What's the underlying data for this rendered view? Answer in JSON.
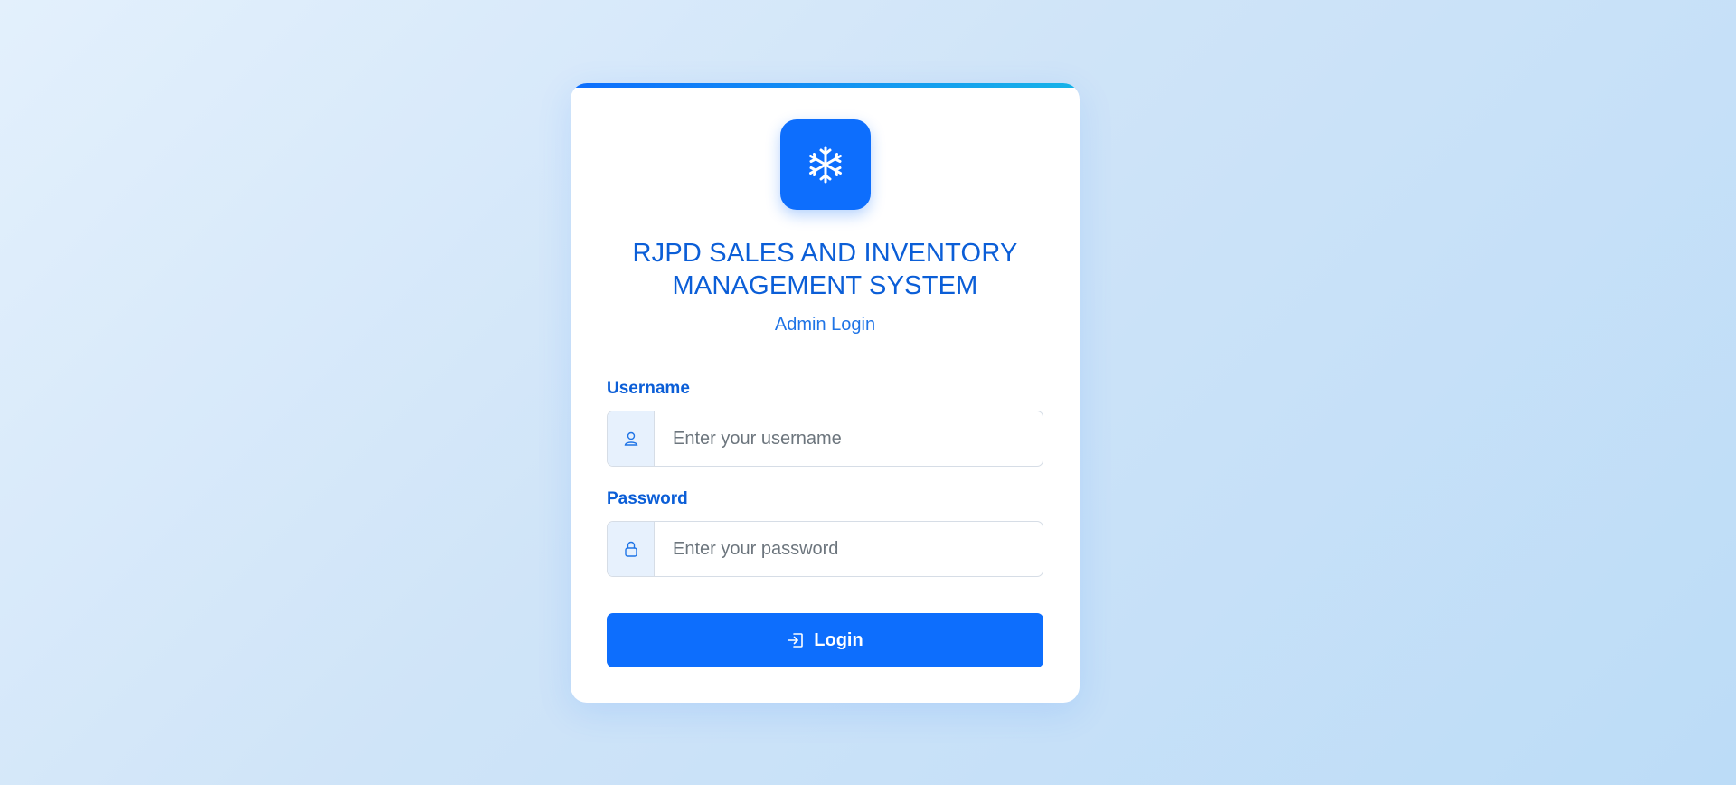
{
  "app": {
    "title_line1": "RJPD SALES AND INVENTORY",
    "title_line2": "MANAGEMENT SYSTEM",
    "subtitle": "Admin Login",
    "logo_icon": "snowflake-icon"
  },
  "form": {
    "username": {
      "label": "Username",
      "placeholder": "Enter your username",
      "value": "",
      "icon": "user-icon"
    },
    "password": {
      "label": "Password",
      "placeholder": "Enter your password",
      "value": "",
      "icon": "lock-icon"
    },
    "submit": {
      "label": "Login",
      "icon": "login-icon"
    }
  },
  "colors": {
    "primary": "#0d6efd",
    "heading": "#0b5ed7",
    "accent_gradient_end": "#17b3e8"
  }
}
